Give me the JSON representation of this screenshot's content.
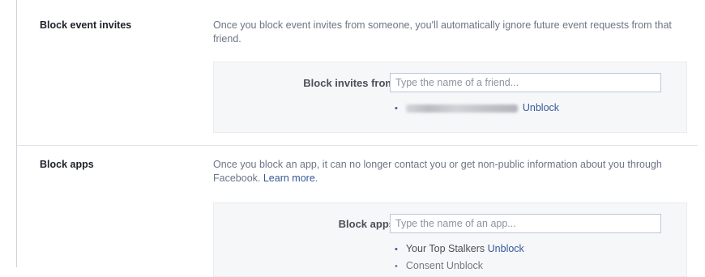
{
  "event_invites": {
    "label": "Block event invites",
    "description": "Once you block event invites from someone, you'll automatically ignore future event requests from that friend.",
    "field_label": "Block invites from",
    "input_placeholder": "Type the name of a friend...",
    "blocked": [
      {
        "name_hidden": true,
        "action": "Unblock"
      }
    ]
  },
  "apps": {
    "label": "Block apps",
    "description": "Once you block an app, it can no longer contact you or get non-public information about you through Facebook.",
    "learn_more": "Learn more",
    "learn_more_suffix": ".",
    "field_label": "Block apps",
    "input_placeholder": "Type the name of an app...",
    "blocked": [
      {
        "name": "Your Top Stalkers",
        "action": "Unblock"
      },
      {
        "name": "Consent Unblock",
        "partial": true
      }
    ]
  },
  "colors": {
    "link": "#365899",
    "panel_bg": "#f6f7f9",
    "muted_text": "#6c7585"
  }
}
